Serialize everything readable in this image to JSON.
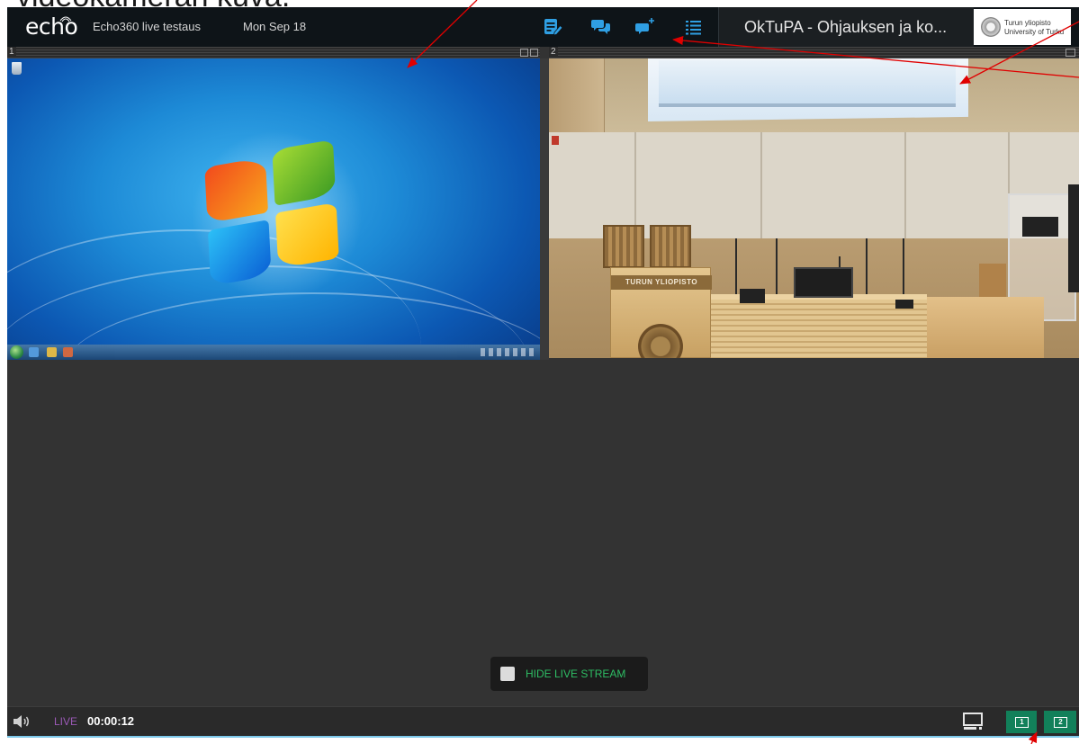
{
  "annotation": {
    "caption": "videokameran kuva."
  },
  "header": {
    "logo": "echo",
    "course_title": "Echo360 live testaus",
    "date": "Mon Sep 18",
    "toolbar_icons": [
      "notes-icon",
      "discussion-icon",
      "ask-question-icon",
      "outline-icon"
    ],
    "section_title": "OkTuPA - Ohjauksen ja ko...",
    "university_logo": {
      "line1": "Turun yliopisto",
      "line2": "University of Turku"
    }
  },
  "panels": [
    {
      "label": "1"
    },
    {
      "label": "2",
      "podium_text": "TURUN YLIOPISTO"
    }
  ],
  "hide_stream": {
    "label": "HIDE LIVE STREAM",
    "checked": false
  },
  "player": {
    "live_label": "LIVE",
    "elapsed": "00:00:12",
    "layout_buttons": [
      "1",
      "2"
    ]
  },
  "colors": {
    "header_bg": "#0e1418",
    "icon_blue": "#2f9fe3",
    "stage_bg": "#333333",
    "live_purple": "#9b59b6",
    "hide_green": "#2ebd64",
    "layout_button_green": "#12805a",
    "annotation_red": "#e00000"
  }
}
